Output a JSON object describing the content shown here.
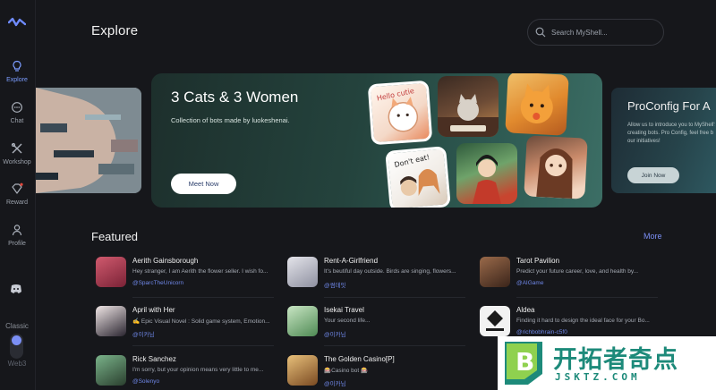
{
  "sidebar": {
    "logo_icon": "myshell-logo-icon",
    "items": [
      {
        "label": "Explore",
        "icon": "bulb-icon",
        "active": true
      },
      {
        "label": "Chat",
        "icon": "chat-bubble-icon",
        "active": false
      },
      {
        "label": "Workshop",
        "icon": "tools-icon",
        "active": false
      },
      {
        "label": "Reward",
        "icon": "gem-icon",
        "active": false
      },
      {
        "label": "Profile",
        "icon": "person-icon",
        "active": false
      }
    ],
    "discord_icon": "discord-icon",
    "mode_classic": "Classic",
    "mode_web3": "Web3"
  },
  "header": {
    "title": "Explore",
    "search_placeholder": "Search MyShell..."
  },
  "carousel": {
    "main": {
      "title": "3 Cats & 3 Women",
      "subtitle": "Collection of bots made by luokeshenai.",
      "button": "Meet Now",
      "thumb_texts": [
        "Hello cutie",
        "Don't eat!"
      ]
    },
    "right": {
      "title": "ProConfig For A",
      "desc_lines": [
        "Allow us to introduce you to MyShell's",
        "creating bots. Pro Config, feel free b",
        "our initiatives!"
      ],
      "button": "Join Now"
    }
  },
  "featured": {
    "title": "Featured",
    "more": "More",
    "bots": [
      {
        "name": "Aerith Gainsborough",
        "desc": "Hey stranger, I am Aerith the flower seller. I wish fo...",
        "author": "@SparcTheUnicorn",
        "color": "#a23a55"
      },
      {
        "name": "Rent-A-Girlfriend",
        "desc": "It's beutiful day outside. Birds are singing, flowers...",
        "author": "@썸데잇",
        "color": "#b8b9c4"
      },
      {
        "name": "Tarot Pavilion",
        "desc": "Predict your future career, love, and health by...",
        "author": "@AIGame",
        "color": "#6b4a3a"
      },
      {
        "name": "April with Her",
        "desc": "✍ Epic Visual Novel : Solid game system, Emotion...",
        "author": "@이카님",
        "color": "#3a3540"
      },
      {
        "name": "Isekai Travel",
        "desc": "Your second life...",
        "author": "@이카님",
        "color": "#7fb07a"
      },
      {
        "name": "Aldea",
        "desc": "Finding it hard to design the ideal face for your Bo...",
        "author": "@richbobhrain-c5f0",
        "color": "#e8e8e8"
      },
      {
        "name": "Rick Sanchez",
        "desc": "I'm sorry, but your opinion means very little to me...",
        "author": "@Solenyo",
        "color": "#3d5a3e"
      },
      {
        "name": "The Golden Casino[P]",
        "desc": "🎰Casino bot 🎰",
        "author": "@이카님",
        "color": "#b8863e"
      }
    ]
  },
  "watermark": {
    "cn": "开拓者奇点",
    "en": "JSKTZ.COM",
    "logo_letter": "B"
  }
}
